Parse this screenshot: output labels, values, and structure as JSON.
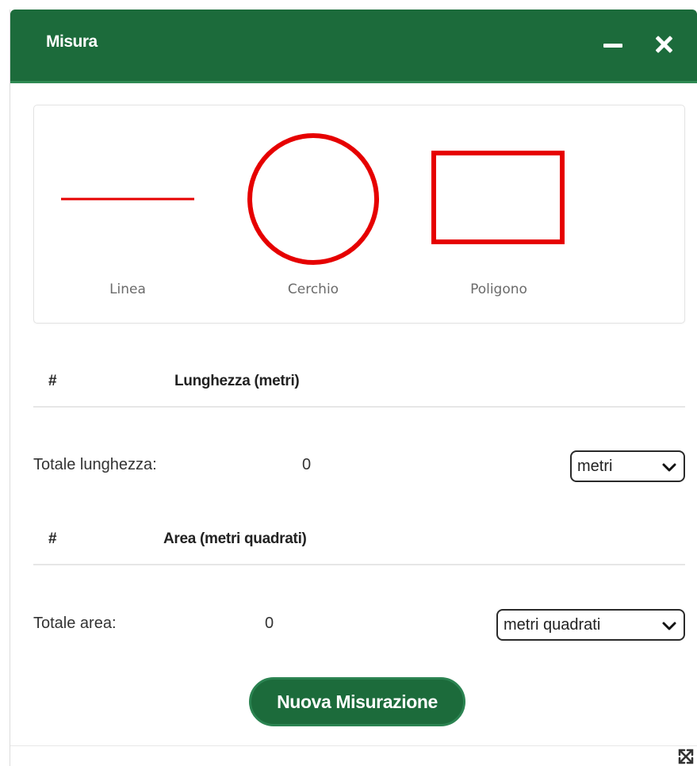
{
  "window": {
    "title": "Misura",
    "minimize_icon": "minimize-icon",
    "close_icon": "close-icon",
    "resize_icon": "expand-arrows-icon"
  },
  "tools": [
    {
      "label": "Linea",
      "icon": "line-icon"
    },
    {
      "label": "Cerchio",
      "icon": "circle-icon"
    },
    {
      "label": "Poligono",
      "icon": "polygon-icon"
    }
  ],
  "colors": {
    "header_green": "#1c6b3b",
    "tool_red": "#e60000"
  },
  "length": {
    "header_hash": "#",
    "header_column": "Lunghezza (metri)",
    "total_label": "Totale lunghezza:",
    "total_value": "0",
    "unit_selected": "metri"
  },
  "area": {
    "header_hash": "#",
    "header_column": "Area (metri quadrati)",
    "total_label": "Totale area:",
    "total_value": "0",
    "unit_selected": "metri quadrati"
  },
  "actions": {
    "new_measurement": "Nuova Misurazione"
  }
}
